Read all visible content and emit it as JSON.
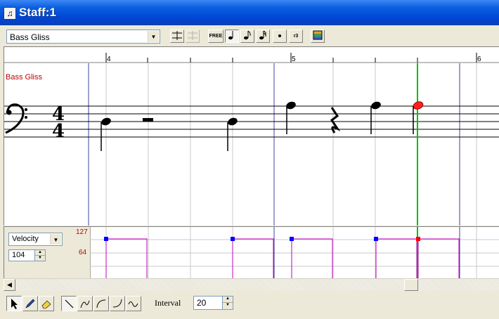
{
  "window": {
    "title": "Staff:1"
  },
  "toolbar": {
    "track_select": "Bass Gliss",
    "free_label": "FREE",
    "triplet_label": "r3"
  },
  "staff": {
    "track_label": "Bass Gliss",
    "clef": "bass",
    "time_signature_top": "4",
    "time_signature_bottom": "4",
    "measure_numbers": [
      "4",
      "5",
      "6"
    ],
    "colors": {
      "track_label": "#c00000",
      "measure_line": "#4040a0",
      "playhead": "#00c000",
      "selected_note": "#ff2020"
    }
  },
  "velocity": {
    "mode_select": "Velocity",
    "value": "104",
    "max_label": "127",
    "mid_label": "64",
    "colors": {
      "handle": "#0000ff",
      "selected_handle": "#ff0000",
      "line": "#c000c0"
    }
  },
  "bottom": {
    "interval_label": "Interval",
    "interval_value": "20"
  }
}
